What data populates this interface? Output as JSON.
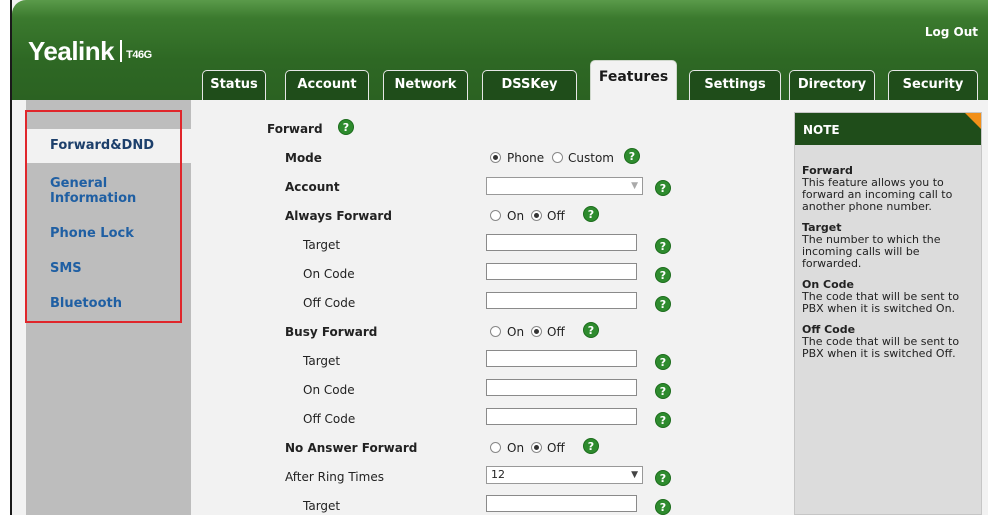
{
  "header": {
    "brand": "Yealink",
    "model": "T46G",
    "logout_label": "Log Out"
  },
  "tabs": [
    {
      "label": "Status"
    },
    {
      "label": "Account"
    },
    {
      "label": "Network"
    },
    {
      "label": "DSSKey"
    },
    {
      "label": "Features",
      "active": true
    },
    {
      "label": "Settings"
    },
    {
      "label": "Directory"
    },
    {
      "label": "Security"
    }
  ],
  "sidebar": {
    "items": [
      {
        "label": "Forward&DND",
        "active": true
      },
      {
        "label": "General Information"
      },
      {
        "label": "Phone Lock"
      },
      {
        "label": "SMS"
      },
      {
        "label": "Bluetooth"
      }
    ]
  },
  "main": {
    "section_title": "Forward",
    "mode": {
      "label": "Mode",
      "options": [
        "Phone",
        "Custom"
      ],
      "selected": "Phone"
    },
    "account": {
      "label": "Account",
      "value": ""
    },
    "always_forward": {
      "label": "Always Forward",
      "options": [
        "On",
        "Off"
      ],
      "selected": "Off",
      "fields": [
        {
          "label": "Target",
          "value": ""
        },
        {
          "label": "On Code",
          "value": ""
        },
        {
          "label": "Off Code",
          "value": ""
        }
      ]
    },
    "busy_forward": {
      "label": "Busy Forward",
      "options": [
        "On",
        "Off"
      ],
      "selected": "Off",
      "fields": [
        {
          "label": "Target",
          "value": ""
        },
        {
          "label": "On Code",
          "value": ""
        },
        {
          "label": "Off Code",
          "value": ""
        }
      ]
    },
    "no_answer_forward": {
      "label": "No Answer Forward",
      "options": [
        "On",
        "Off"
      ],
      "selected": "Off"
    },
    "after_ring_times": {
      "label": "After Ring Times",
      "value": "12"
    },
    "na_target": {
      "label": "Target",
      "value": ""
    },
    "help_glyph": "?"
  },
  "note": {
    "title": "NOTE",
    "entries": [
      {
        "term": "Forward",
        "text": "This feature allows you to forward an incoming call to another phone number."
      },
      {
        "term": "Target",
        "text": "The number to which the incoming calls will be forwarded."
      },
      {
        "term": "On Code",
        "text": "The code that will be sent to PBX when it is switched On."
      },
      {
        "term": "Off Code",
        "text": "The code that will be sent to PBX when it is switched Off."
      }
    ]
  },
  "colors": {
    "header_green": "#2e6824",
    "tab_dark": "#1f4d1a",
    "link_blue": "#1f5fa3",
    "help_green": "#2e8b2e",
    "highlight_red": "#e0262b",
    "note_corner": "#f29019"
  }
}
